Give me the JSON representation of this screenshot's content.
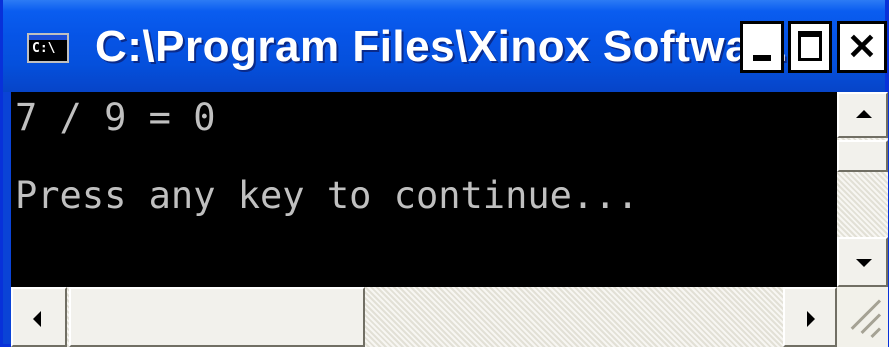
{
  "window": {
    "title": "C:\\Program Files\\Xinox Softwa...",
    "icon": "console-icon",
    "icon_text": "C:\\"
  },
  "console": {
    "lines": [
      "7 / 9 = 0",
      "Press any key to continue..."
    ],
    "background": "#000000",
    "foreground": "#c0c0c0"
  },
  "controls": [
    "minimize-icon",
    "maximize-icon",
    "close-icon"
  ],
  "colors": {
    "titlebar": "#0654e6",
    "frame": "#0831d9"
  }
}
